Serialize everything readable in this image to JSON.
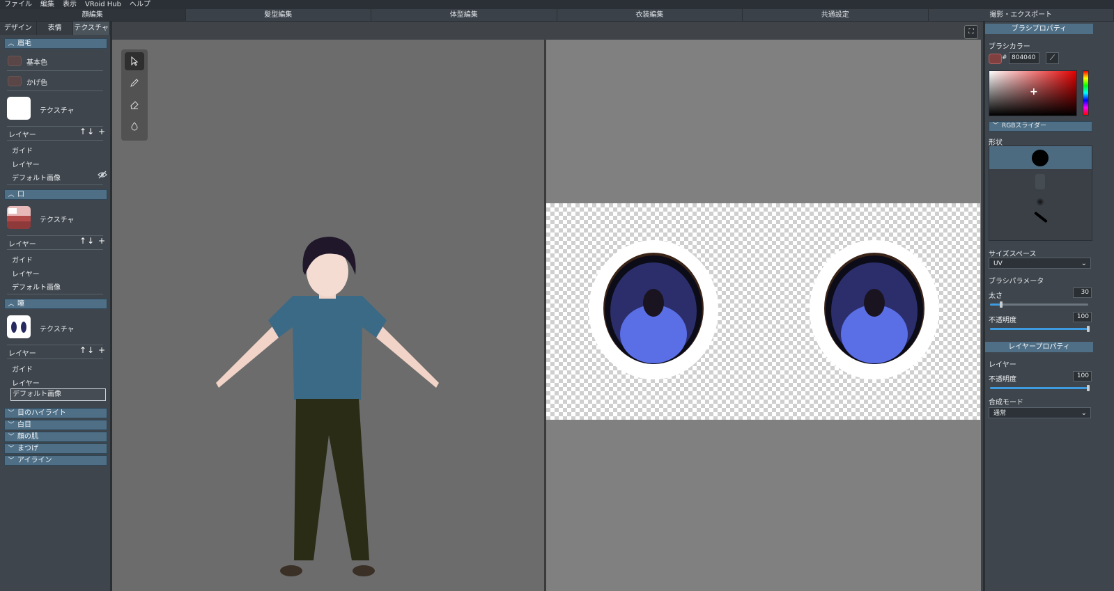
{
  "menu": [
    "ファイル",
    "編集",
    "表示",
    "VRoid Hub",
    "ヘルプ"
  ],
  "main_tabs": [
    "顔編集",
    "髪型編集",
    "体型編集",
    "衣装編集",
    "共通設定",
    "撮影・エクスポート"
  ],
  "sub_tabs": [
    "デザイン",
    "表情",
    "テクスチャ"
  ],
  "left_panel": {
    "eyebrow": {
      "title": "眉毛",
      "base_color": "基本色",
      "shadow_color": "かげ色",
      "texture": "テクスチャ",
      "layer_label": "レイヤー",
      "arrows": "↑↓ +",
      "layers": [
        "ガイド",
        "レイヤー",
        "デフォルト画像"
      ]
    },
    "mouth": {
      "title": "口",
      "texture": "テクスチャ",
      "layer_label": "レイヤー",
      "arrows": "↑↓ +",
      "layers": [
        "ガイド",
        "レイヤー",
        "デフォルト画像"
      ]
    },
    "iris": {
      "title": "瞳",
      "texture": "テクスチャ",
      "layer_label": "レイヤー",
      "arrows": "↑↓ +",
      "layers": [
        "ガイド",
        "レイヤー",
        "デフォルト画像"
      ]
    },
    "collapsed_sections": [
      "目のハイライト",
      "白目",
      "顔の肌",
      "まつげ",
      "アイライン"
    ]
  },
  "tools": [
    "select-tool",
    "pen-tool",
    "eraser-tool",
    "fill-tool"
  ],
  "right_panel": {
    "brush_header": "ブラシプロパティ",
    "brush_color_label": "ブラシカラー",
    "hash": "#",
    "hex_value": "804040",
    "brush_color": "#804040",
    "plus": "+",
    "rgb_slider_label": "RGBスライダー",
    "shape_label": "形状",
    "size_space_label": "サイズスペース",
    "size_space_value": "UV",
    "brush_params_label": "ブラシパラメータ",
    "thickness_label": "太さ",
    "thickness_value": "30",
    "opacity_label": "不透明度",
    "opacity_value": "100",
    "layer_header": "レイヤープロパティ",
    "layer_label": "レイヤー",
    "layer_opacity_label": "不透明度",
    "layer_opacity_value": "100",
    "blend_mode_label": "合成モード",
    "blend_mode_value": "通常"
  }
}
